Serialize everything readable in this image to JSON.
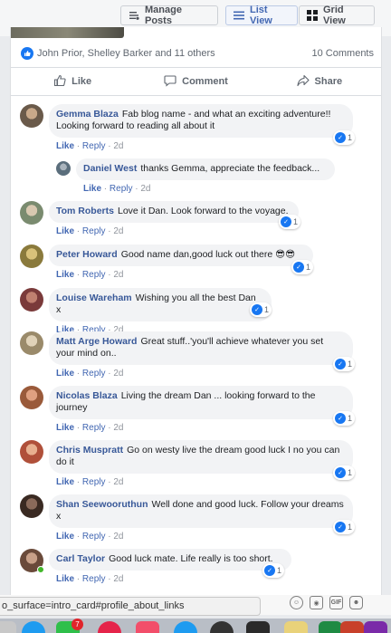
{
  "toolbar": {
    "manage_posts": "Manage Posts",
    "list_view": "List View",
    "grid_view": "Grid View"
  },
  "post": {
    "reactors": "John Prior, Shelley Barker and 11 others",
    "comments_count": "10 Comments",
    "actions": {
      "like": "Like",
      "comment": "Comment",
      "share": "Share"
    }
  },
  "comments": [
    {
      "author": "Gemma Blaza",
      "text": "Fab blog name - and what an exciting adventure!! Looking forward to reading all about it",
      "like": "Like",
      "reply": "Reply",
      "time": "2d",
      "reactions": "1",
      "avatar_color": "#6a5a4a"
    },
    {
      "author": "Daniel West",
      "text": "thanks Gemma, appreciate the feedback...",
      "like": "Like",
      "reply": "Reply",
      "time": "2d",
      "reactions": "",
      "avatar_color": "#5b6e7c"
    },
    {
      "author": "Tom Roberts",
      "text": "Love it Dan. Look forward to the voyage.",
      "like": "Like",
      "reply": "Reply",
      "time": "2d",
      "reactions": "1",
      "avatar_color": "#7a8b6f"
    },
    {
      "author": "Peter Howard",
      "text": "Good name dan,good luck out there 😎😎",
      "like": "Like",
      "reply": "Reply",
      "time": "2d",
      "reactions": "1",
      "avatar_color": "#8a7a3c"
    },
    {
      "author": "Louise Wareham",
      "text": "Wishing you all the best Dan x",
      "like": "Like",
      "reply": "Reply",
      "time": "2d",
      "reactions": "1",
      "avatar_color": "#7a3a3a"
    },
    {
      "author": "Matt Arge Howard",
      "text": "Great stuff..'you'll achieve whatever you set your mind on..",
      "like": "Like",
      "reply": "Reply",
      "time": "2d",
      "reactions": "1",
      "avatar_color": "#9a8a6a"
    },
    {
      "author": "Nicolas Blaza",
      "text": "Living the dream Dan ... looking forward to the journey",
      "like": "Like",
      "reply": "Reply",
      "time": "2d",
      "reactions": "1",
      "avatar_color": "#9a5a3a"
    },
    {
      "author": "Chris Muspratt",
      "text": "Go on westy live the dream good luck I no you can do it",
      "like": "Like",
      "reply": "Reply",
      "time": "2d",
      "reactions": "1",
      "avatar_color": "#b0503a"
    },
    {
      "author": "Shan Seewooruthun",
      "text": "Well done and good luck. Follow your dreams x",
      "like": "Like",
      "reply": "Reply",
      "time": "2d",
      "reactions": "1",
      "avatar_color": "#3a2a22"
    },
    {
      "author": "Carl Taylor",
      "text": "Good luck mate. Life really is too short.",
      "like": "Like",
      "reply": "Reply",
      "time": "2d",
      "reactions": "1",
      "avatar_color": "#6a4a3a"
    }
  ],
  "status_url": "o_surface=intro_card#profile_about_links",
  "composer_icons": [
    "emoji-icon",
    "camera-icon",
    "gif-icon",
    "sticker-icon"
  ],
  "dock": {
    "badge": "7"
  },
  "colors": {
    "link": "#385898",
    "accent": "#4267b2",
    "like_blue": "#1877f2"
  }
}
